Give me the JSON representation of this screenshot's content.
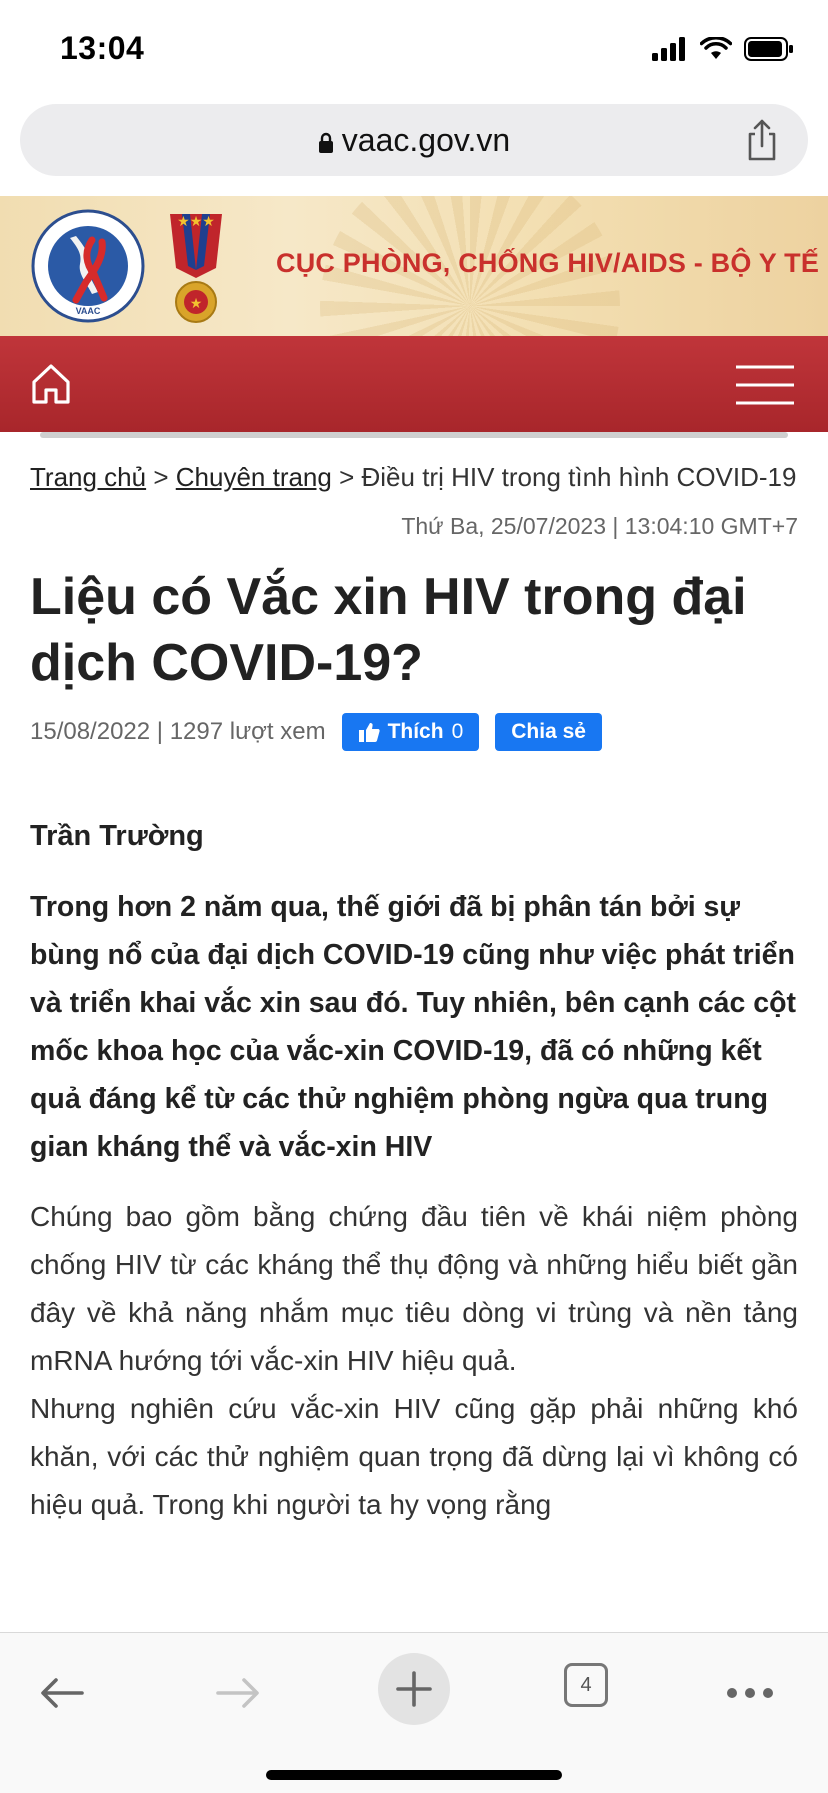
{
  "status_bar": {
    "time": "13:04"
  },
  "browser": {
    "url": "vaac.gov.vn",
    "open_tabs": "4"
  },
  "site": {
    "logo_text_top": "CỤC PHÒNG, CHỐNG HIV/AIDS - BỘ Y TẾ",
    "logo_text_bottom": "VAAC",
    "organization": "CỤC PHÒNG, CHỐNG HIV/AIDS - BỘ Y TẾ"
  },
  "breadcrumb": {
    "home": "Trang chủ",
    "sep1": " > ",
    "section": "Chuyên trang",
    "sep2": " > ",
    "current": "Điều trị HIV trong tình hình COVID-19"
  },
  "dateline": "Thứ Ba, 25/07/2023 | 13:04:10 GMT+7",
  "article": {
    "title": "Liệu có Vắc xin HIV trong đại dịch COVID-19?",
    "meta": "15/08/2022 | 1297 lượt xem",
    "like_label": "Thích",
    "like_count": "0",
    "share_label": "Chia sẻ",
    "author": "Trần Trường",
    "lead": "Trong hơn 2 năm qua, thế giới đã bị phân tán bởi sự bùng nổ của đại dịch COVID-19 cũng như việc phát triển và triển khai vắc xin sau đó. Tuy nhiên, bên cạnh các cột mốc khoa học của vắc-xin COVID-19, đã có những kết quả đáng kể từ các thử nghiệm phòng ngừa qua trung gian kháng thể và vắc-xin HIV",
    "paragraphs": [
      "Chúng bao gồm bằng chứng đầu tiên về khái niệm phòng chống HIV từ các kháng thể thụ động và những hiểu biết gần đây về khả năng nhắm mục tiêu dòng vi trùng và nền tảng mRNA hướng tới vắc-xin HIV hiệu quả.",
      "Nhưng nghiên cứu vắc-xin HIV cũng gặp phải những khó khăn, với các thử nghiệm quan trọng đã dừng lại vì không có hiệu quả. Trong khi người ta hy vọng rằng"
    ]
  },
  "colors": {
    "brand_red": "#b22a2f",
    "facebook_blue": "#1877f2",
    "org_text": "#c9302c"
  }
}
